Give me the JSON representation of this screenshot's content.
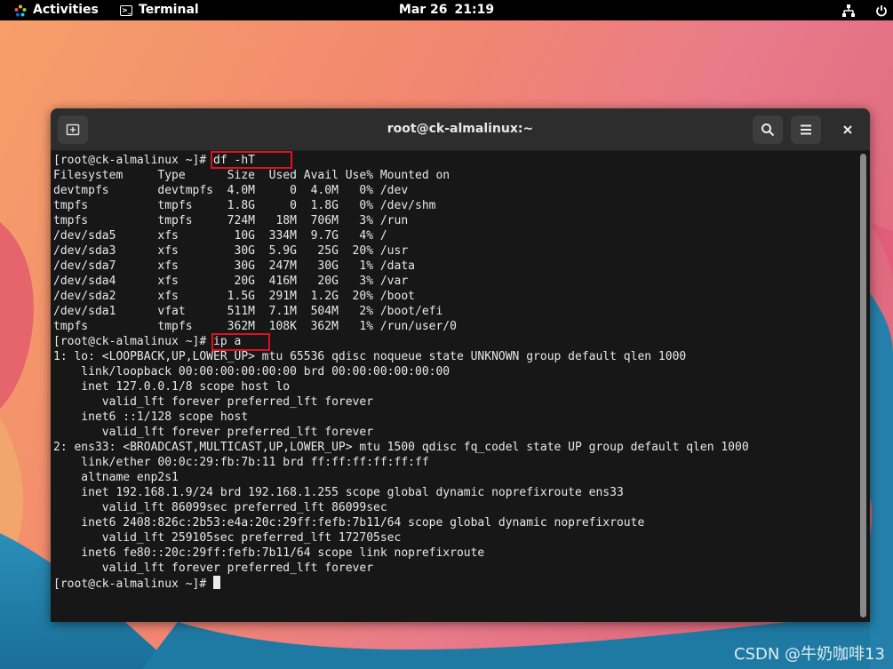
{
  "topbar": {
    "activities_label": "Activities",
    "app_label": "Terminal",
    "clock_date": "Mar 26",
    "clock_time": "21:19",
    "network_icon": "network-wired-icon",
    "power_icon": "power-icon"
  },
  "window": {
    "title": "root@ck-almalinux:~",
    "new_tab_icon": "new-tab-icon",
    "search_icon": "search-icon",
    "menu_icon": "hamburger-menu-icon",
    "close_icon": "close-icon"
  },
  "terminal": {
    "lines": [
      "[root@ck-almalinux ~]# df -hT",
      "Filesystem     Type      Size  Used Avail Use% Mounted on",
      "devtmpfs       devtmpfs  4.0M     0  4.0M   0% /dev",
      "tmpfs          tmpfs     1.8G     0  1.8G   0% /dev/shm",
      "tmpfs          tmpfs     724M   18M  706M   3% /run",
      "/dev/sda5      xfs        10G  334M  9.7G   4% /",
      "/dev/sda3      xfs        30G  5.9G   25G  20% /usr",
      "/dev/sda7      xfs        30G  247M   30G   1% /data",
      "/dev/sda4      xfs        20G  416M   20G   3% /var",
      "/dev/sda2      xfs       1.5G  291M  1.2G  20% /boot",
      "/dev/sda1      vfat      511M  7.1M  504M   2% /boot/efi",
      "tmpfs          tmpfs     362M  108K  362M   1% /run/user/0",
      "[root@ck-almalinux ~]# ip a",
      "1: lo: <LOOPBACK,UP,LOWER_UP> mtu 65536 qdisc noqueue state UNKNOWN group default qlen 1000",
      "    link/loopback 00:00:00:00:00:00 brd 00:00:00:00:00:00",
      "    inet 127.0.0.1/8 scope host lo",
      "       valid_lft forever preferred_lft forever",
      "    inet6 ::1/128 scope host",
      "       valid_lft forever preferred_lft forever",
      "2: ens33: <BROADCAST,MULTICAST,UP,LOWER_UP> mtu 1500 qdisc fq_codel state UP group default qlen 1000",
      "    link/ether 00:0c:29:fb:7b:11 brd ff:ff:ff:ff:ff:ff",
      "    altname enp2s1",
      "    inet 192.168.1.9/24 brd 192.168.1.255 scope global dynamic noprefixroute ens33",
      "       valid_lft 86099sec preferred_lft 86099sec",
      "    inet6 2408:826c:2b53:e4a:20c:29ff:fefb:7b11/64 scope global dynamic noprefixroute",
      "       valid_lft 259105sec preferred_lft 172705sec",
      "    inet6 fe80::20c:29ff:fefb:7b11/64 scope link noprefixroute",
      "       valid_lft forever preferred_lft forever",
      "[root@ck-almalinux ~]# "
    ]
  },
  "watermark": "CSDN @牛奶咖啡13",
  "colors": {
    "terminal_bg": "#171717",
    "headerbar_bg": "#2d2d2d",
    "text": "#e8e8e8",
    "highlight_box": "#e01020"
  }
}
